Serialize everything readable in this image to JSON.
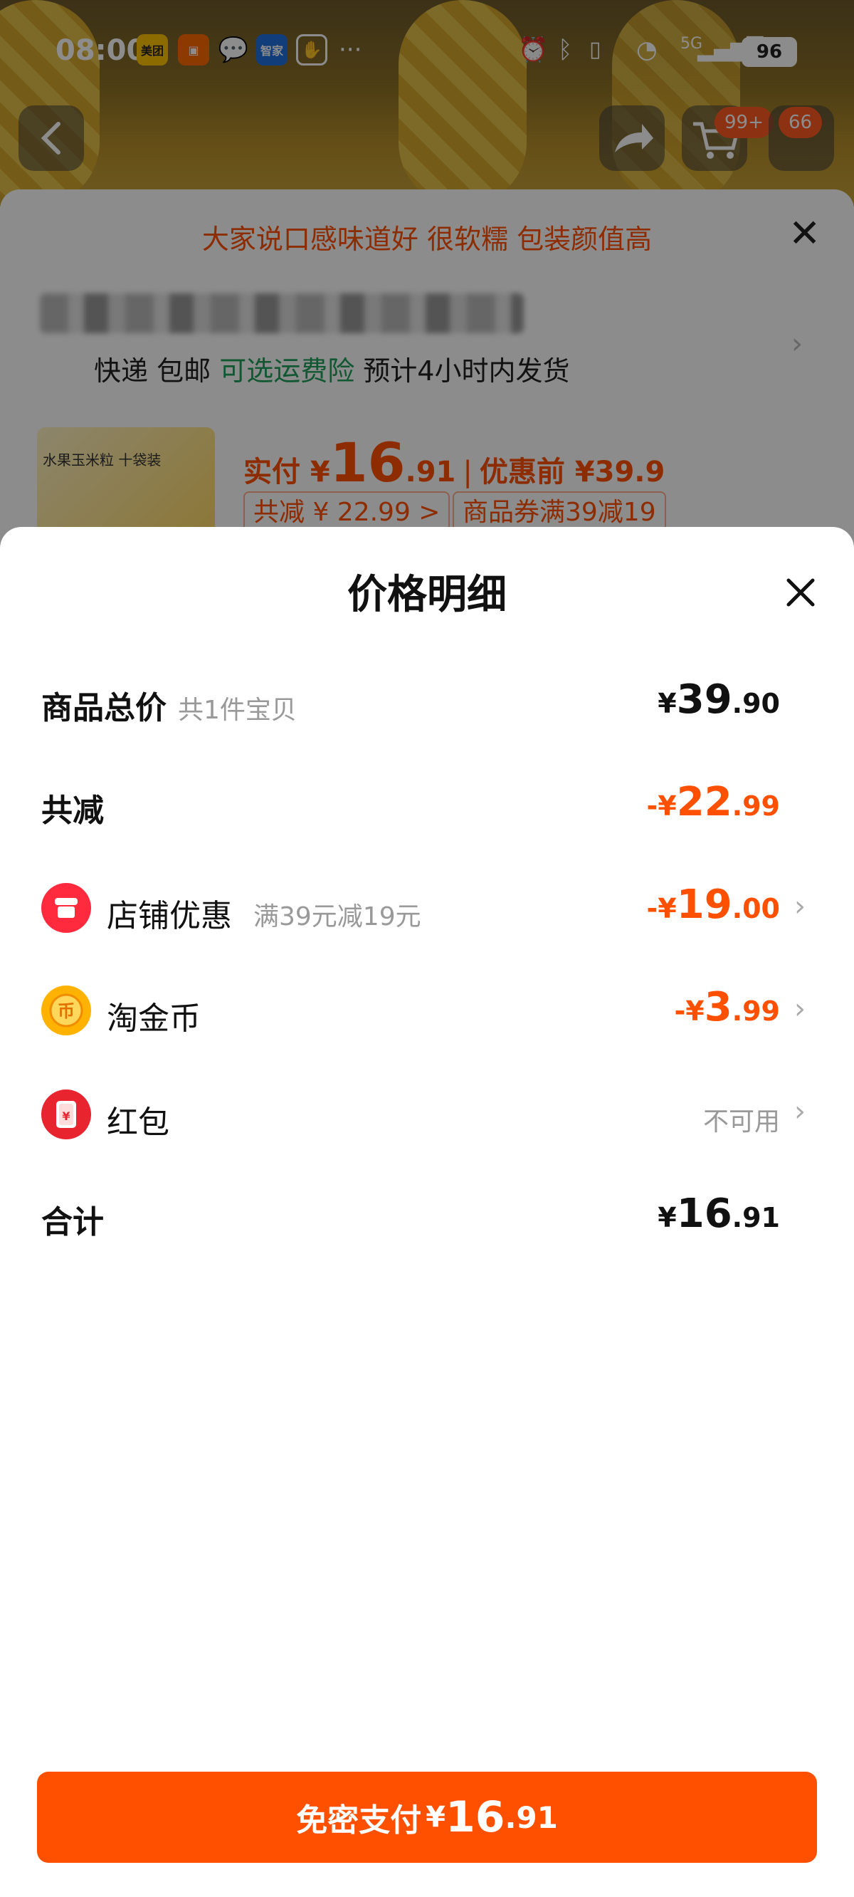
{
  "status_bar": {
    "time": "08:00",
    "battery": "96",
    "network": "5G",
    "app_icons": [
      "美团",
      "智家"
    ]
  },
  "background": {
    "badges": [
      "99+",
      "66"
    ],
    "tagline": "大家说口感味道好 很软糯 包装颜值高",
    "shipping": {
      "express": "快递 包邮",
      "insurance": "可选运费险",
      "eta": "预计4小时内发货"
    },
    "product_label": "水果玉米粒 十袋装",
    "pay": {
      "prefix": "实付 ¥",
      "int": "16",
      "dec": ".91",
      "before": "优惠前 ¥39.9"
    },
    "tags": [
      "共减 ¥ 22.99 >",
      "商品券满39减19"
    ]
  },
  "sheet": {
    "title": "价格明细",
    "rows": [
      {
        "label": "商品总价",
        "sub": "共1件宝贝",
        "cur": "¥",
        "int": "39",
        "dec": ".90"
      },
      {
        "label": "共减",
        "cur": "-¥",
        "int": "22",
        "dec": ".99"
      },
      {
        "label": "店铺优惠",
        "sub": "满39元减19元",
        "cur": "-¥",
        "int": "19",
        "dec": ".00"
      },
      {
        "label": "淘金币",
        "cur": "-¥",
        "int": "3",
        "dec": ".99"
      },
      {
        "label": "红包",
        "status": "不可用"
      },
      {
        "label": "合计",
        "cur": "¥",
        "int": "16",
        "dec": ".91"
      }
    ],
    "pay_button": {
      "label": "免密支付",
      "cur": "¥",
      "int": "16",
      "dec": ".91"
    }
  },
  "colors": {
    "accent": "#ff5000",
    "insurance_green": "#1f9e5a"
  }
}
